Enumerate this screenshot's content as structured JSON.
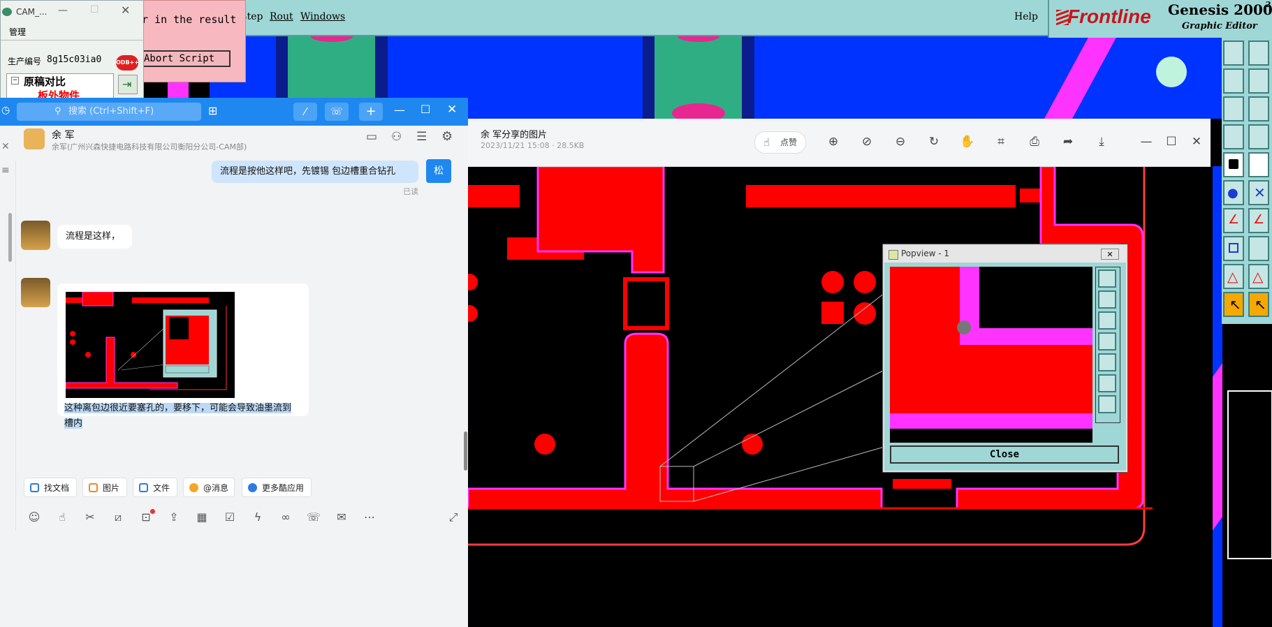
{
  "genesis": {
    "menu": [
      "Step",
      "Rout",
      "Windows"
    ],
    "help": "Help",
    "brand": "Frontline",
    "product": "Genesis 2000",
    "product_sup": "2",
    "subtitle": "Graphic Editor",
    "right_label": "Grap"
  },
  "cam_window": {
    "title": "CAM_...",
    "menu": "管理",
    "serial_label": "生产编号",
    "serial_value": "8g15c03ia0",
    "db_icon_label": "ODB++",
    "tree_root": "原稿对比",
    "tree_child": "板外物件"
  },
  "script_dialog": {
    "message": "r in the result",
    "abort_label": "Abort Script"
  },
  "chat": {
    "search_placeholder": "搜索 (Ctrl+Shift+F)",
    "contact_name": "余 军",
    "contact_subtitle": "余军(广州兴森快捷电路科技有限公司衡阳分公司-CAM部)",
    "messages": {
      "sent_text": "流程是按他这样吧，先镀锡  包边槽重合钻孔",
      "sent_avatar": "松",
      "read_status": "已读",
      "recv1_text": "流程是这样，",
      "recv2_caption": "这种离包边很近要塞孔的，要移下，可能会导致油墨流到槽内"
    },
    "quick_actions": [
      "找文档",
      "图片",
      "文件",
      "@消息",
      "更多酷应用"
    ]
  },
  "viewer": {
    "title": "余 军分享的图片",
    "meta": "2023/11/21 15:08 · 28.5KB",
    "like_label": "点赞"
  },
  "popview": {
    "title": "Popview - 1",
    "close_label": "Close"
  },
  "colors": {
    "copper": "#ff0000",
    "outline": "#ff33ff",
    "genesis_teal": "#9fd7d6",
    "chat_blue": "#1e88f0",
    "board_blue": "#0033ff"
  }
}
